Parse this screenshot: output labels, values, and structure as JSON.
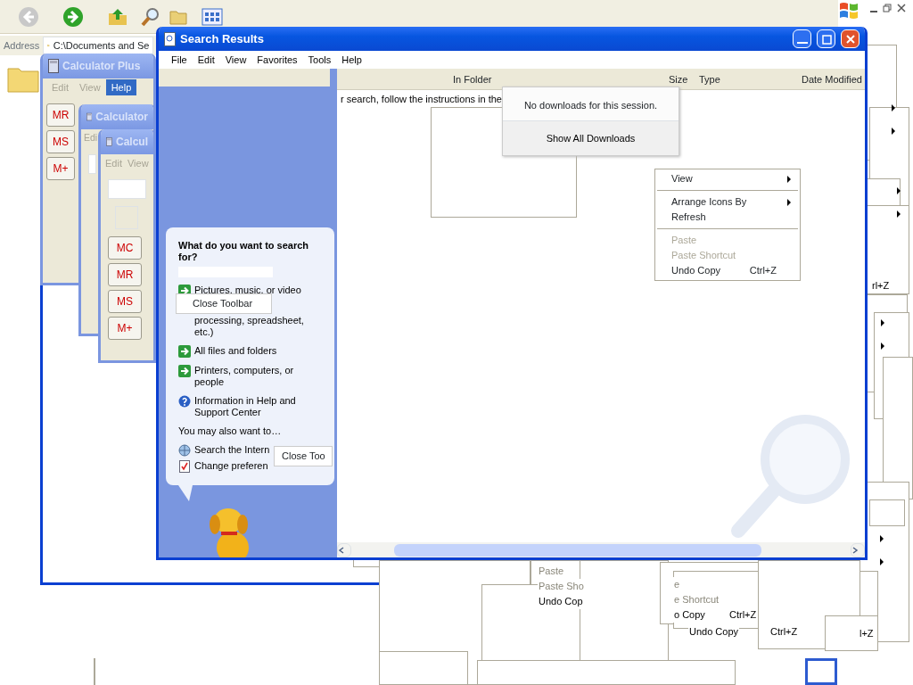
{
  "explorer": {
    "address_label": "Address",
    "address_value": "C:\\Documents and Se"
  },
  "calculators": [
    {
      "title": "Calculator Plus",
      "menu": [
        {
          "label": "Edit",
          "selected": false
        },
        {
          "label": "View",
          "selected": false
        },
        {
          "label": "Help",
          "selected": true
        }
      ],
      "keys": [
        "MR",
        "MS",
        "M+"
      ]
    },
    {
      "title": "Calculator",
      "menu": [
        {
          "label": "Edi",
          "selected": false
        }
      ]
    },
    {
      "title": "Calcul",
      "menu": [
        {
          "label": "Edit",
          "selected": false
        },
        {
          "label": "View",
          "selected": false
        }
      ],
      "keys": [
        "MC",
        "MR",
        "MS",
        "M+"
      ]
    }
  ],
  "search_window": {
    "title": "Search Results",
    "menu": [
      "File",
      "Edit",
      "View",
      "Favorites",
      "Tools",
      "Help"
    ],
    "columns": [
      "In Folder",
      "Size",
      "Type",
      "Date Modified"
    ],
    "message": "r search, follow the instructions in the",
    "assistant": {
      "heading": "What do you want to search for?",
      "options": [
        {
          "kind": "arrow",
          "text": "Pictures, music, or video"
        },
        {
          "kind": "none",
          "text": "processing, spreadsheet, etc.)"
        },
        {
          "kind": "arrow",
          "text": "All files and folders"
        },
        {
          "kind": "arrow",
          "text": "Printers, computers, or people"
        },
        {
          "kind": "help",
          "text": "Information in Help and Support Center"
        }
      ],
      "also_label": "You may also want to…",
      "links": [
        {
          "kind": "globe",
          "text": "Search the Intern"
        },
        {
          "kind": "prefs",
          "text": "Change preferen"
        }
      ]
    }
  },
  "tooltips": [
    "Close Toolbar",
    "Close Too"
  ],
  "downloads_popup": {
    "message": "No downloads for this session.",
    "button": "Show All Downloads"
  },
  "context_menu": [
    {
      "kind": "item",
      "label": "View",
      "submenu": true,
      "disabled": false
    },
    {
      "kind": "separator"
    },
    {
      "kind": "item",
      "label": "Arrange Icons By",
      "submenu": true,
      "disabled": false
    },
    {
      "kind": "item",
      "label": "Refresh",
      "submenu": false,
      "disabled": false
    },
    {
      "kind": "separator"
    },
    {
      "kind": "item",
      "label": "Paste",
      "submenu": false,
      "disabled": true
    },
    {
      "kind": "item",
      "label": "Paste Shortcut",
      "submenu": false,
      "disabled": true
    },
    {
      "kind": "item",
      "label": "Undo Copy",
      "shortcut": "Ctrl+Z",
      "submenu": false,
      "disabled": false
    }
  ],
  "ghost_texts": [
    {
      "text": "Paste",
      "disabled": true
    },
    {
      "text": "Paste Sho",
      "disabled": true
    },
    {
      "text": "Undo Cop",
      "disabled": false
    },
    {
      "text": "e",
      "disabled": true
    },
    {
      "text": "e Shortcut",
      "disabled": true
    },
    {
      "text": "o Copy",
      "disabled": false
    },
    {
      "text": "Ctrl+Z",
      "disabled": false
    },
    {
      "text": "Undo Copy",
      "disabled": false
    },
    {
      "text": "Ctrl+Z",
      "disabled": false
    },
    {
      "text": "l+Z",
      "disabled": false
    },
    {
      "text": "rl+Z",
      "disabled": false
    }
  ]
}
